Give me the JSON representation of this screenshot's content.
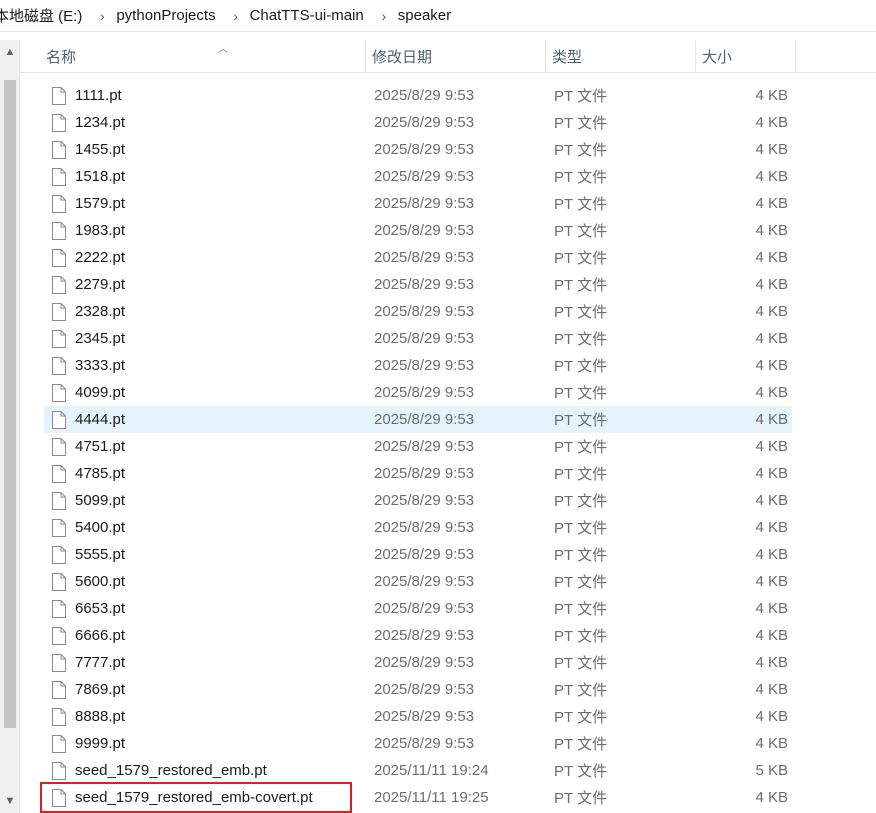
{
  "breadcrumb": [
    "本地磁盘 (E:)",
    "pythonProjects",
    "ChatTTS-ui-main",
    "speaker"
  ],
  "columns": {
    "name": "名称",
    "date": "修改日期",
    "type": "类型",
    "size": "大小"
  },
  "icons": {
    "file": "file-icon",
    "separator": "chevron-right-icon",
    "scroll_up": "scroll-up-arrow-icon",
    "scroll_down": "scroll-down-arrow-icon"
  },
  "files": [
    {
      "name": "1111.pt",
      "date": "2025/8/29 9:53",
      "type": "PT 文件",
      "size": "4 KB"
    },
    {
      "name": "1234.pt",
      "date": "2025/8/29 9:53",
      "type": "PT 文件",
      "size": "4 KB"
    },
    {
      "name": "1455.pt",
      "date": "2025/8/29 9:53",
      "type": "PT 文件",
      "size": "4 KB"
    },
    {
      "name": "1518.pt",
      "date": "2025/8/29 9:53",
      "type": "PT 文件",
      "size": "4 KB"
    },
    {
      "name": "1579.pt",
      "date": "2025/8/29 9:53",
      "type": "PT 文件",
      "size": "4 KB"
    },
    {
      "name": "1983.pt",
      "date": "2025/8/29 9:53",
      "type": "PT 文件",
      "size": "4 KB"
    },
    {
      "name": "2222.pt",
      "date": "2025/8/29 9:53",
      "type": "PT 文件",
      "size": "4 KB"
    },
    {
      "name": "2279.pt",
      "date": "2025/8/29 9:53",
      "type": "PT 文件",
      "size": "4 KB"
    },
    {
      "name": "2328.pt",
      "date": "2025/8/29 9:53",
      "type": "PT 文件",
      "size": "4 KB"
    },
    {
      "name": "2345.pt",
      "date": "2025/8/29 9:53",
      "type": "PT 文件",
      "size": "4 KB"
    },
    {
      "name": "3333.pt",
      "date": "2025/8/29 9:53",
      "type": "PT 文件",
      "size": "4 KB"
    },
    {
      "name": "4099.pt",
      "date": "2025/8/29 9:53",
      "type": "PT 文件",
      "size": "4 KB"
    },
    {
      "name": "4444.pt",
      "date": "2025/8/29 9:53",
      "type": "PT 文件",
      "size": "4 KB",
      "hovered": true
    },
    {
      "name": "4751.pt",
      "date": "2025/8/29 9:53",
      "type": "PT 文件",
      "size": "4 KB"
    },
    {
      "name": "4785.pt",
      "date": "2025/8/29 9:53",
      "type": "PT 文件",
      "size": "4 KB"
    },
    {
      "name": "5099.pt",
      "date": "2025/8/29 9:53",
      "type": "PT 文件",
      "size": "4 KB"
    },
    {
      "name": "5400.pt",
      "date": "2025/8/29 9:53",
      "type": "PT 文件",
      "size": "4 KB"
    },
    {
      "name": "5555.pt",
      "date": "2025/8/29 9:53",
      "type": "PT 文件",
      "size": "4 KB"
    },
    {
      "name": "5600.pt",
      "date": "2025/8/29 9:53",
      "type": "PT 文件",
      "size": "4 KB"
    },
    {
      "name": "6653.pt",
      "date": "2025/8/29 9:53",
      "type": "PT 文件",
      "size": "4 KB"
    },
    {
      "name": "6666.pt",
      "date": "2025/8/29 9:53",
      "type": "PT 文件",
      "size": "4 KB"
    },
    {
      "name": "7777.pt",
      "date": "2025/8/29 9:53",
      "type": "PT 文件",
      "size": "4 KB"
    },
    {
      "name": "7869.pt",
      "date": "2025/8/29 9:53",
      "type": "PT 文件",
      "size": "4 KB"
    },
    {
      "name": "8888.pt",
      "date": "2025/8/29 9:53",
      "type": "PT 文件",
      "size": "4 KB"
    },
    {
      "name": "9999.pt",
      "date": "2025/8/29 9:53",
      "type": "PT 文件",
      "size": "4 KB"
    },
    {
      "name": "seed_1579_restored_emb.pt",
      "date": "2025/11/11 19:24",
      "type": "PT 文件",
      "size": "5 KB"
    },
    {
      "name": "seed_1579_restored_emb-covert.pt",
      "date": "2025/11/11 19:25",
      "type": "PT 文件",
      "size": "4 KB",
      "annotated": true
    }
  ],
  "colors": {
    "hover_row": "#e5f3ff",
    "annotation_box": "#d62222",
    "header_text": "#4c607a"
  }
}
